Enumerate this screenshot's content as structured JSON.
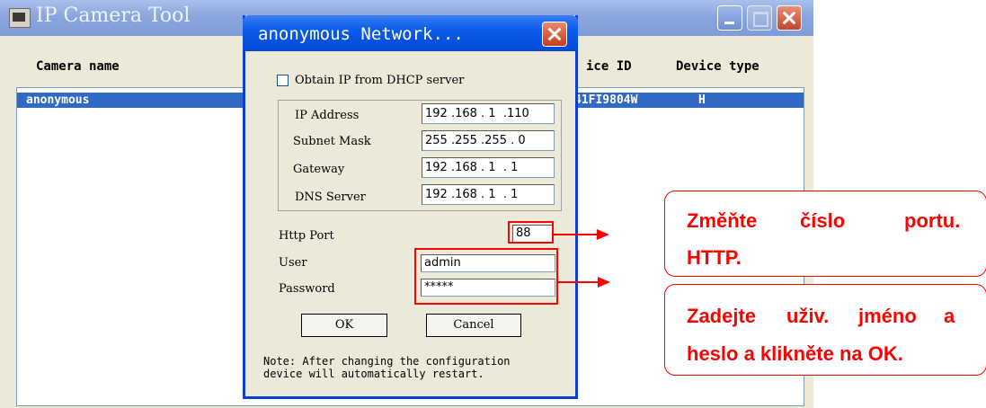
{
  "main_window": {
    "title": "IP Camera Tool",
    "columns": {
      "camera_name": "Camera name",
      "device_id": "ice ID",
      "device_type": "Device type"
    },
    "row": {
      "camera_name": "anonymous",
      "device_id": "41FI9804W",
      "device_type": "H"
    }
  },
  "dialog": {
    "title": "anonymous Network...",
    "dhcp_label": "Obtain IP from DHCP server",
    "dhcp_checked": false,
    "ip_label": "IP Address",
    "ip_value": "192 .168 . 1  .110",
    "mask_label": "Subnet Mask",
    "mask_value": "255 .255 .255 . 0",
    "gateway_label": "Gateway",
    "gateway_value": "192 .168 . 1  . 1",
    "dns_label": "DNS Server",
    "dns_value": "192 .168 . 1  . 1",
    "http_port_label": "Http Port",
    "http_port_value": "88",
    "user_label": "User",
    "user_value": "admin",
    "password_label": "Password",
    "password_value": "*****",
    "ok_label": "OK",
    "cancel_label": "Cancel",
    "note": "Note: After changing the configuration\ndevice will automatically restart."
  },
  "callouts": {
    "port_line1": [
      "Změňte",
      "číslo",
      "portu."
    ],
    "port_line2": "HTTP.",
    "login_line1": [
      "Zadejte",
      "uživ.",
      "jméno",
      "a"
    ],
    "login_line2": "heslo a klikněte na OK."
  },
  "colors": {
    "annotation": "#ff0000",
    "selection": "#316ac5",
    "title_bar": "#0b5ce8"
  }
}
